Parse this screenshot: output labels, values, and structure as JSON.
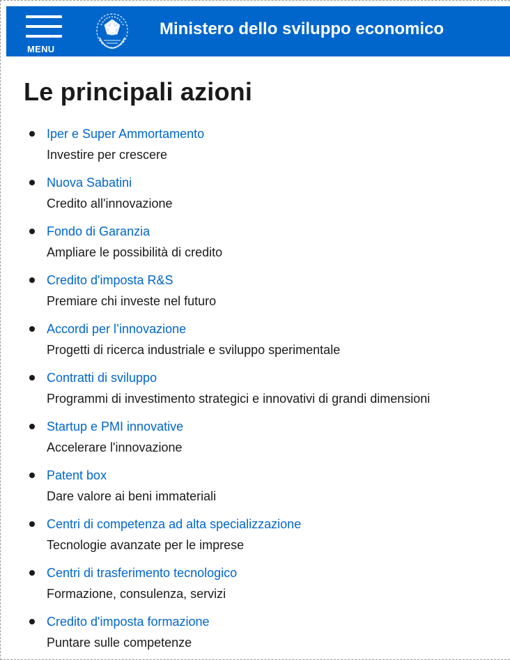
{
  "header": {
    "menu_label": "MENU",
    "site_title": "Ministero dello sviluppo economico",
    "logo_icon": "italian-republic-emblem-icon",
    "bar_color": "#0066cc"
  },
  "main": {
    "title": "Le principali azioni",
    "link_color": "#0066cc",
    "actions": [
      {
        "label": "Iper e Super Ammortamento",
        "description": "Investire per crescere"
      },
      {
        "label": "Nuova Sabatini",
        "description": "Credito all'innovazione"
      },
      {
        "label": "Fondo di Garanzia",
        "description": "Ampliare le possibilità di credito"
      },
      {
        "label": "Credito d'imposta R&S",
        "description": "Premiare chi investe nel futuro"
      },
      {
        "label": "Accordi per l’innovazione",
        "description": "Progetti di ricerca industriale e sviluppo sperimentale"
      },
      {
        "label": "Contratti di sviluppo",
        "description": "Programmi di investimento strategici e innovativi di grandi dimensioni"
      },
      {
        "label": "Startup e PMI innovative",
        "description": "Accelerare l'innovazione"
      },
      {
        "label": "Patent box",
        "description": "Dare valore ai beni immateriali"
      },
      {
        "label": "Centri di competenza ad alta specializzazione",
        "description": "Tecnologie avanzate per le imprese"
      },
      {
        "label": "Centri di trasferimento tecnologico",
        "description": "Formazione, consulenza, servizi"
      },
      {
        "label": "Credito d'imposta formazione",
        "description": "Puntare sulle competenze"
      }
    ]
  }
}
